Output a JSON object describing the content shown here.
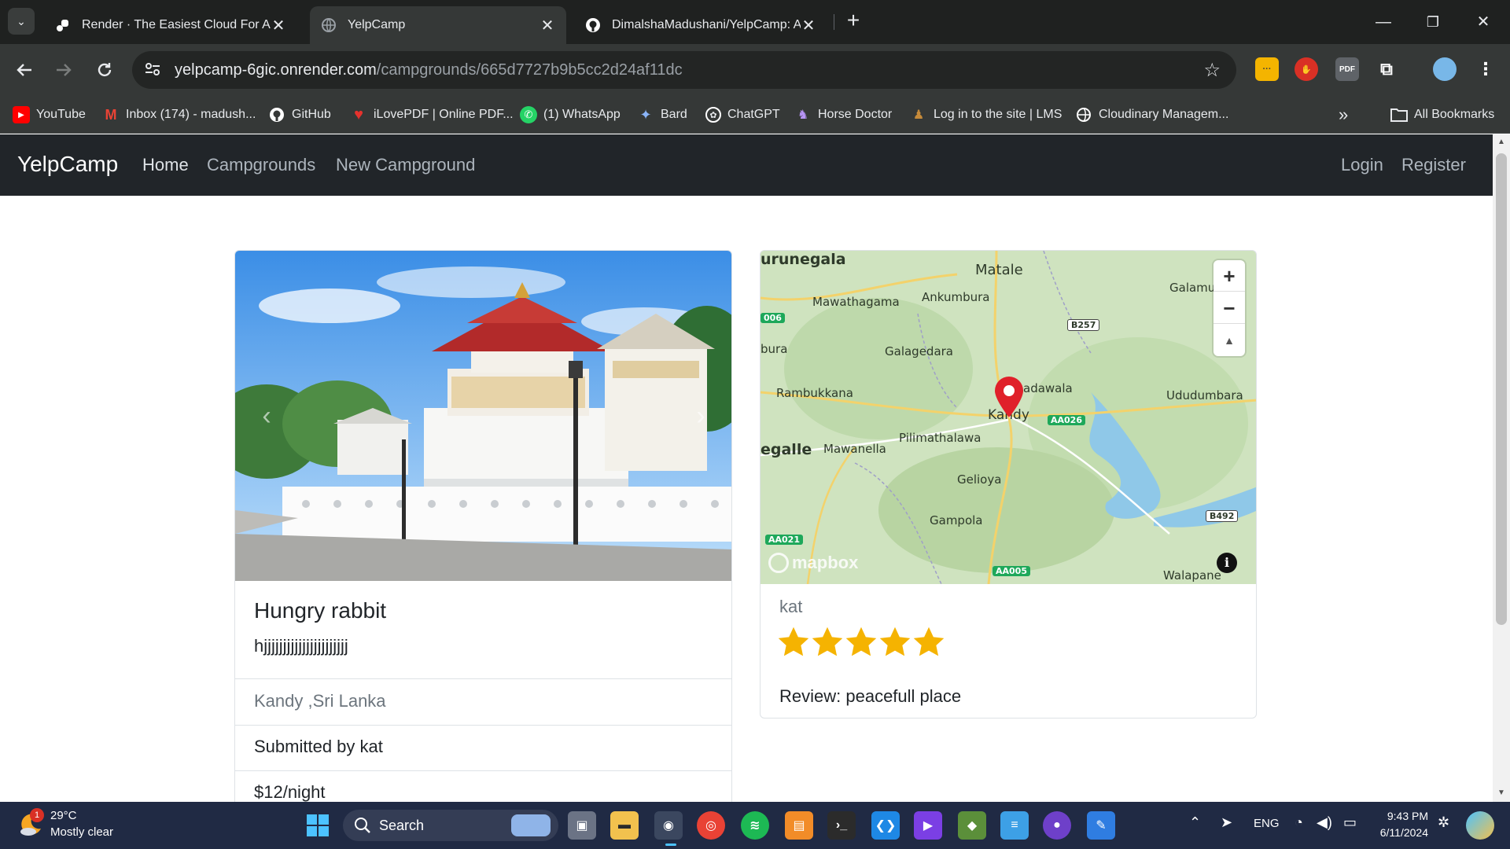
{
  "browser": {
    "tabs": [
      {
        "title": "Render · The Easiest Cloud For All",
        "active": false,
        "close": "✕"
      },
      {
        "title": "YelpCamp",
        "active": true,
        "close": "✕"
      },
      {
        "title": "DimalshaMadushani/YelpCamp: A",
        "active": false,
        "close": "✕"
      }
    ],
    "new_tab": "+",
    "window_controls": {
      "minimize": "—",
      "restore": "❐",
      "close": "✕"
    },
    "url_host": "yelpcamp-6gic.onrender.com",
    "url_path": "/campgrounds/665d7727b9b5cc2d24af11dc",
    "bookmarks": [
      {
        "label": "YouTube",
        "icon": "youtube-icon",
        "color": "#ff0000"
      },
      {
        "label": "Inbox (174) - madush...",
        "icon": "gmail-icon",
        "color": "#ea4335"
      },
      {
        "label": "GitHub",
        "icon": "github-icon",
        "color": "#ffffff"
      },
      {
        "label": "iLovePDF | Online PDF...",
        "icon": "ilovepdf-icon",
        "color": "#e5322d"
      },
      {
        "label": "(1) WhatsApp",
        "icon": "whatsapp-icon",
        "color": "#25d366"
      },
      {
        "label": "Bard",
        "icon": "bard-icon",
        "color": "#8ab4f8"
      },
      {
        "label": "ChatGPT",
        "icon": "chatgpt-icon",
        "color": "#ffffff"
      },
      {
        "label": "Horse Doctor",
        "icon": "horse-icon",
        "color": "#b794f6"
      },
      {
        "label": "Log in to the site | LMS",
        "icon": "lms-icon",
        "color": "#c58a3a"
      },
      {
        "label": "Cloudinary Managem...",
        "icon": "cloudinary-icon",
        "color": "#ffffff"
      }
    ],
    "bookmarks_overflow": "»",
    "all_bookmarks": "All Bookmarks"
  },
  "site": {
    "brand": "YelpCamp",
    "nav": [
      "Home",
      "Campgrounds",
      "New Campground"
    ],
    "auth": [
      "Login",
      "Register"
    ]
  },
  "campground": {
    "title": "Hungry rabbit",
    "description": "hjjjjjjjjjjjjjjjjjjjjjj",
    "location": "Kandy ,Sri Lanka",
    "submitted_by": "Submitted by kat",
    "price": "$12/night",
    "carousel_prev": "‹",
    "carousel_next": "›"
  },
  "map": {
    "labels": [
      "urunegala",
      "Matale",
      "Galamu",
      "Mawathagama",
      "Ankumbura",
      "B257",
      "006",
      "bura",
      "Galagedara",
      "Rambukkana",
      "adawala",
      "Kandy",
      "Ududumbara",
      "AA026",
      "egalle",
      "Mawanella",
      "Pilimathalawa",
      "Gelioya",
      "Gampola",
      "B492",
      "AA021",
      "AA005",
      "Walapane"
    ],
    "zoom_in": "+",
    "zoom_out": "−",
    "compass": "▲",
    "attribution_logo": "mapbox",
    "info": "i"
  },
  "review": {
    "author": "kat",
    "rating": 5,
    "rating_max": 5,
    "text": "Review: peacefull place"
  },
  "taskbar": {
    "temp": "29°C",
    "weather": "Mostly clear",
    "weather_badge": "1",
    "search": "Search",
    "lang": "ENG",
    "time": "9:43 PM",
    "date": "6/11/2024"
  },
  "colors": {
    "navbar": "#212529",
    "star": "#f5b301",
    "pin": "#e0202a",
    "road_badge": "#1ea85a"
  }
}
